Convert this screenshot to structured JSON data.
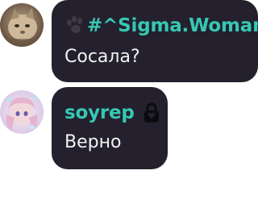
{
  "messages": [
    {
      "author": "#^Sigma.Woman",
      "author_icon": "paw-icon",
      "text": "Сосала?",
      "avatar": "cat-photo-avatar"
    },
    {
      "author": "soyrep",
      "author_icon": "lock-icon",
      "text": "Верно",
      "avatar": "anime-art-avatar"
    }
  ],
  "colors": {
    "bubble_background": "#24202d",
    "author_name": "#36c8b4",
    "message_text": "#f2f2f2",
    "page_background": "#ffffff"
  }
}
